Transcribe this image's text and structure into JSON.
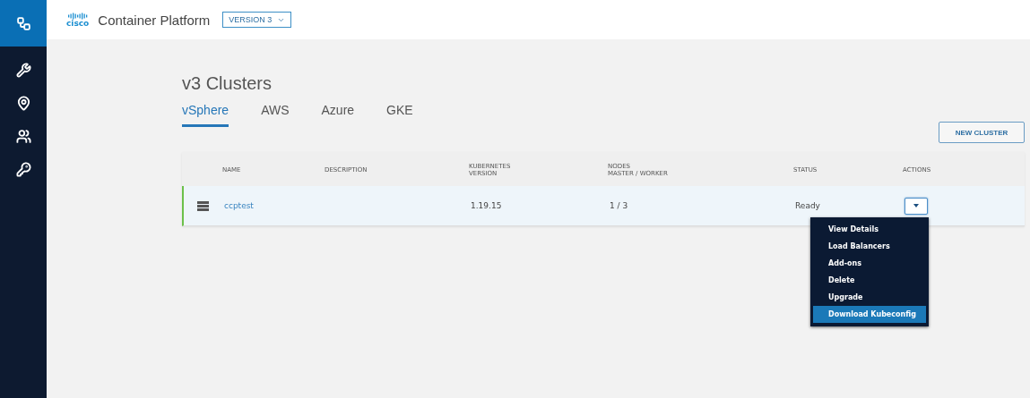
{
  "sidebar": {
    "items": [
      {
        "selected": true
      },
      {
        "selected": false
      },
      {
        "selected": false
      },
      {
        "selected": false
      },
      {
        "selected": false
      }
    ]
  },
  "topbar": {
    "logo_text": "cisco",
    "title": "Container Platform",
    "version_select": "VERSION 3"
  },
  "page": {
    "title": "v3 Clusters",
    "tabs": [
      {
        "label": "vSphere",
        "selected": true
      },
      {
        "label": "AWS",
        "selected": false
      },
      {
        "label": "Azure",
        "selected": false
      },
      {
        "label": "GKE",
        "selected": false
      }
    ],
    "new_button": "NEW CLUSTER"
  },
  "table": {
    "columns": [
      {
        "label": "NAME"
      },
      {
        "label": "DESCRIPTION"
      },
      {
        "label": "KUBERNETES\nVERSION"
      },
      {
        "label": "NODES\nMASTER / WORKER"
      },
      {
        "label": "STATUS"
      },
      {
        "label": "ACTIONS"
      }
    ],
    "rows": [
      {
        "name": "ccptest",
        "description": "",
        "version": "1.19.15",
        "nodes": "1 / 3",
        "status": "Ready",
        "menu_open": true
      }
    ]
  },
  "actions_menu": [
    {
      "label": "View Details",
      "selected": false
    },
    {
      "label": "Load Balancers",
      "selected": false
    },
    {
      "label": "Add-ons",
      "selected": false
    },
    {
      "label": "Delete",
      "selected": false
    },
    {
      "label": "Upgrade",
      "selected": false
    },
    {
      "label": "Download Kubeconfig",
      "selected": true
    }
  ]
}
